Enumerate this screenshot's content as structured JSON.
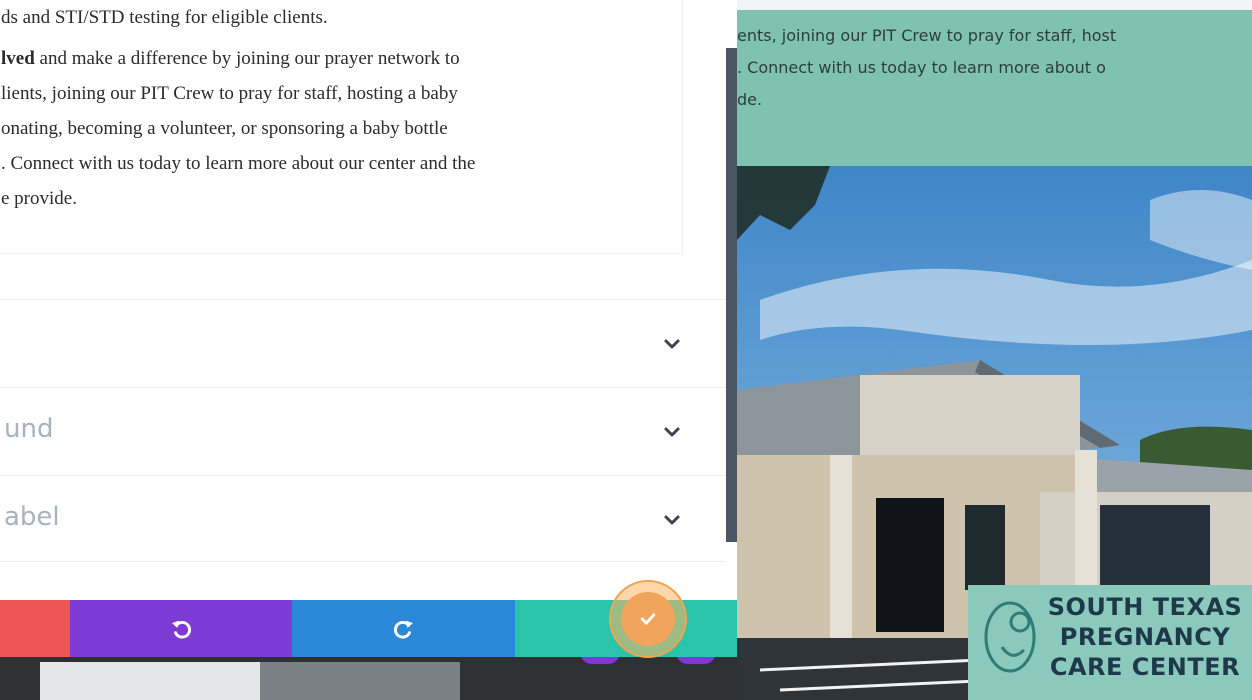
{
  "panel": {
    "body_lines": [
      "ds and STI/STD testing for eligible clients."
    ],
    "paragraph2": {
      "bold_prefix": "lved",
      "line1_rest": " and make a difference by joining our prayer network to",
      "line2": "lients, joining our PIT Crew to pray for staff, hosting a baby",
      "line3": "onating, becoming a volunteer, or sponsoring a baby bottle",
      "line4": ". Connect with us today to learn more about our center and the",
      "line5": "e provide."
    },
    "accordions": [
      {
        "label": ""
      },
      {
        "label": "und"
      },
      {
        "label": "abel"
      }
    ]
  },
  "preview": {
    "lines": [
      "ents, joining our PIT Crew to pray for staff, host",
      ". Connect with us today to learn more about o",
      "de."
    ]
  },
  "sign": {
    "lines": [
      "SOUTH TEXAS",
      "PREGNANCY",
      "CARE CENTER"
    ]
  },
  "action_bar": {
    "colors": {
      "discard": "#ef5555",
      "undo": "#7d3bd6",
      "redo": "#2b88d8",
      "save": "#29c4a9",
      "highlight": "#f0a45c"
    },
    "icons": {
      "undo": "undo-icon",
      "redo": "redo-icon",
      "save": "check-icon"
    }
  }
}
